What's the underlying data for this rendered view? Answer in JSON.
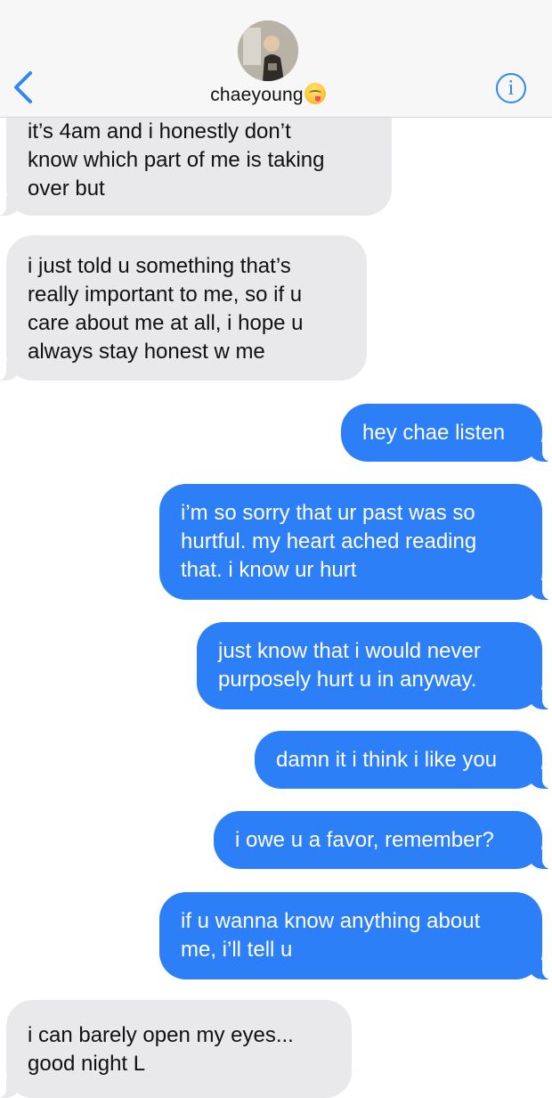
{
  "header": {
    "contact_name": "chaeyoung",
    "back_icon": "chevron-left-icon",
    "info_icon": "info-icon",
    "info_glyph": "i",
    "accent_color": "#2f86f6"
  },
  "messages": [
    {
      "direction": "incoming",
      "text": "it’s 4am and i honestly don’t\nknow which part of me is taking\nover but"
    },
    {
      "direction": "incoming",
      "text": "i just told u something that’s\nreally important to me, so if u\ncare about me at all, i hope u\nalways stay honest w me"
    },
    {
      "direction": "outgoing",
      "text": "hey chae listen"
    },
    {
      "direction": "outgoing",
      "text": "i’m so sorry that ur past was so\nhurtful. my heart ached reading\nthat. i know ur hurt"
    },
    {
      "direction": "outgoing",
      "text": "just know that i would never\npurposely hurt u in anyway."
    },
    {
      "direction": "outgoing",
      "text": "damn it i think i like you"
    },
    {
      "direction": "outgoing",
      "text": "i owe u a favor, remember?"
    },
    {
      "direction": "outgoing",
      "text": "if u wanna know anything about\nme, i’ll tell u"
    },
    {
      "direction": "incoming",
      "text": "i can barely open my eyes...\ngood night L"
    }
  ],
  "colors": {
    "incoming_bubble": "#e9e9eb",
    "outgoing_bubble": "#2c7ff6"
  }
}
